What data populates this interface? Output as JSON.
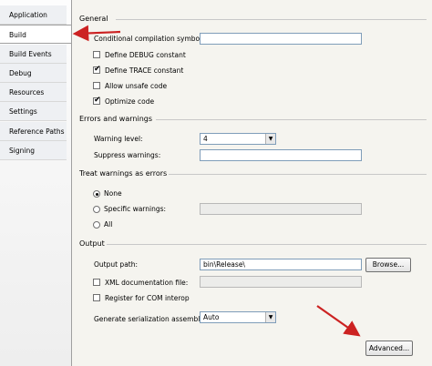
{
  "tabs": [
    {
      "label": "Application"
    },
    {
      "label": "Build"
    },
    {
      "label": "Build Events"
    },
    {
      "label": "Debug"
    },
    {
      "label": "Resources"
    },
    {
      "label": "Settings"
    },
    {
      "label": "Reference Paths"
    },
    {
      "label": "Signing"
    }
  ],
  "general": {
    "header": "General",
    "conditional_label": "Conditional compilation symbols:",
    "conditional_value": "",
    "define_debug_label": "Define DEBUG constant",
    "define_debug_checked": false,
    "define_trace_label": "Define TRACE constant",
    "define_trace_checked": true,
    "allow_unsafe_label": "Allow unsafe code",
    "allow_unsafe_checked": false,
    "optimize_label": "Optimize code",
    "optimize_checked": true
  },
  "errors": {
    "header": "Errors and warnings",
    "warning_level_label": "Warning level:",
    "warning_level_value": "4",
    "suppress_label": "Suppress warnings:",
    "suppress_value": ""
  },
  "treat": {
    "header": "Treat warnings as errors",
    "none_label": "None",
    "specific_label": "Specific warnings:",
    "all_label": "All",
    "selected": "None"
  },
  "output": {
    "header": "Output",
    "path_label": "Output path:",
    "path_value": "bin\\Release\\",
    "browse_label": "Browse...",
    "xml_label": "XML documentation file:",
    "register_label": "Register for COM interop",
    "serialization_label": "Generate serialization assembly:",
    "serialization_value": "Auto",
    "advanced_label": "Advanced..."
  },
  "colors": {
    "annotation_arrow": "#cc2222",
    "input_border": "#7f9db9"
  },
  "icons": {
    "checkmark": "check-icon",
    "dropdown": "chevron-down-icon"
  }
}
